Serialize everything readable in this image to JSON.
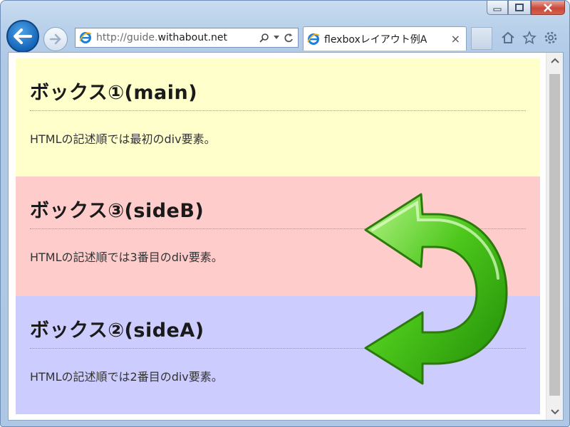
{
  "window": {
    "caption_buttons": [
      "minimize",
      "maximize",
      "close"
    ]
  },
  "navbar": {
    "address": {
      "url_prefix": "http://guide.",
      "url_domain": "withabout.net"
    },
    "tab": {
      "title": "flexboxレイアウト例A",
      "close": "×"
    },
    "icons": [
      "home-icon",
      "star-icon",
      "gear-icon"
    ]
  },
  "page": {
    "boxes": [
      {
        "heading": "ボックス①(main)",
        "text": "HTMLの記述順では最初のdiv要素。",
        "color": "#ffffcc"
      },
      {
        "heading": "ボックス③(sideB)",
        "text": "HTMLの記述順では3番目のdiv要素。",
        "color": "#ffcccc"
      },
      {
        "heading": "ボックス②(sideA)",
        "text": "HTMLの記述順では2番目のdiv要素。",
        "color": "#ccccff"
      }
    ]
  },
  "colors": {
    "arrow": "#4cc71b",
    "accent": "#1565b8"
  }
}
